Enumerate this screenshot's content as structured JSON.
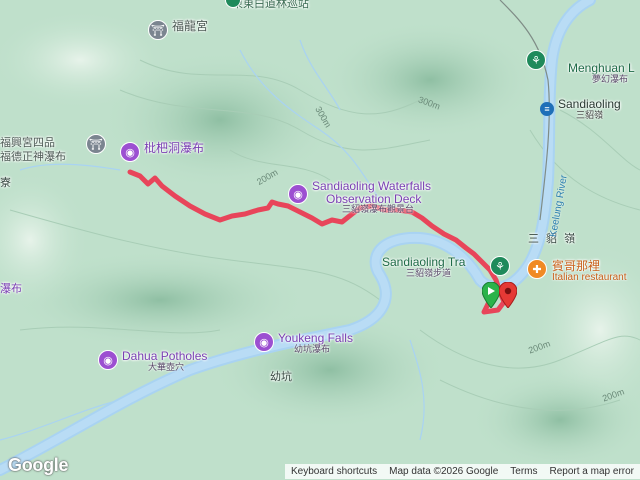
{
  "map": {
    "top_cut_label": "東東白道林巡站",
    "pois": [
      {
        "id": "fulong-temple",
        "en": "福龍宮",
        "zh": "",
        "icon": "temple-icon",
        "type": "gray"
      },
      {
        "id": "fuxing-temple",
        "en": "福興宮四品",
        "zh": "福德正神瀑布",
        "icon": "temple-icon",
        "type": "gray"
      },
      {
        "id": "pipa-waterfall",
        "en": "枇杷洞瀑布",
        "zh": "",
        "icon": "camera-icon",
        "type": "purple"
      },
      {
        "id": "sandiaoling-deck",
        "en": "Sandiaoling Waterfalls",
        "en2": "Observation Deck",
        "zh": "三貂嶺瀑布觀景台",
        "icon": "camera-icon",
        "type": "purple"
      },
      {
        "id": "sandiaoling-trail",
        "en": "Sandiaoling Tra",
        "zh": "三貂嶺步道",
        "icon": "hiking-icon",
        "type": "green"
      },
      {
        "id": "youkeng-falls",
        "en": "Youkeng Falls",
        "zh": "幼坑瀑布",
        "icon": "camera-icon",
        "type": "purple"
      },
      {
        "id": "dahua-potholes",
        "en": "Dahua Potholes",
        "zh": "大華壺穴",
        "icon": "camera-icon",
        "type": "purple"
      },
      {
        "id": "menghuan",
        "en": "Menghuan L",
        "zh": "夢幻瀑布",
        "icon": "hiking-icon",
        "type": "green"
      },
      {
        "id": "sandiaoling-station",
        "en": "Sandiaoling",
        "zh": "三貂嶺",
        "icon": "train-icon",
        "type": "blue"
      },
      {
        "id": "restaurant",
        "en": "賓哥那裡",
        "zh": "Italian restaurant",
        "icon": "food-icon",
        "type": "orange"
      }
    ],
    "place_labels": {
      "left_edge": "寮",
      "left_edge_waterfall": "瀑布",
      "sandiao_area": "三 貂 嶺",
      "youkeng": "幼坑",
      "keelung_river": "Keelung River"
    },
    "contour_labels": [
      "200m",
      "300m",
      "300m",
      "200m",
      "200m"
    ]
  },
  "footer": {
    "keyboard": "Keyboard shortcuts",
    "mapdata": "Map data ©2026 Google",
    "terms": "Terms",
    "report": "Report a map error",
    "logo": "Google"
  },
  "colors": {
    "route": "#e8455a",
    "river": "#a9d3f2",
    "terrain": "#bfe0cb",
    "poi_purple": "#9c4fd1",
    "start_green": "#2bb34a",
    "end_red": "#e53935"
  }
}
